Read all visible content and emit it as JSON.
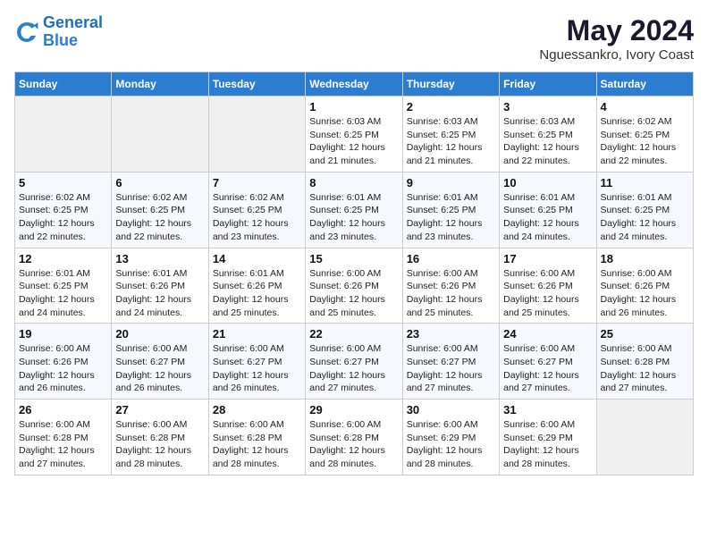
{
  "logo": {
    "line1": "General",
    "line2": "Blue"
  },
  "title": "May 2024",
  "location": "Nguessankro, Ivory Coast",
  "weekdays": [
    "Sunday",
    "Monday",
    "Tuesday",
    "Wednesday",
    "Thursday",
    "Friday",
    "Saturday"
  ],
  "weeks": [
    [
      {
        "day": "",
        "info": ""
      },
      {
        "day": "",
        "info": ""
      },
      {
        "day": "",
        "info": ""
      },
      {
        "day": "1",
        "info": "Sunrise: 6:03 AM\nSunset: 6:25 PM\nDaylight: 12 hours\nand 21 minutes."
      },
      {
        "day": "2",
        "info": "Sunrise: 6:03 AM\nSunset: 6:25 PM\nDaylight: 12 hours\nand 21 minutes."
      },
      {
        "day": "3",
        "info": "Sunrise: 6:03 AM\nSunset: 6:25 PM\nDaylight: 12 hours\nand 22 minutes."
      },
      {
        "day": "4",
        "info": "Sunrise: 6:02 AM\nSunset: 6:25 PM\nDaylight: 12 hours\nand 22 minutes."
      }
    ],
    [
      {
        "day": "5",
        "info": "Sunrise: 6:02 AM\nSunset: 6:25 PM\nDaylight: 12 hours\nand 22 minutes."
      },
      {
        "day": "6",
        "info": "Sunrise: 6:02 AM\nSunset: 6:25 PM\nDaylight: 12 hours\nand 22 minutes."
      },
      {
        "day": "7",
        "info": "Sunrise: 6:02 AM\nSunset: 6:25 PM\nDaylight: 12 hours\nand 23 minutes."
      },
      {
        "day": "8",
        "info": "Sunrise: 6:01 AM\nSunset: 6:25 PM\nDaylight: 12 hours\nand 23 minutes."
      },
      {
        "day": "9",
        "info": "Sunrise: 6:01 AM\nSunset: 6:25 PM\nDaylight: 12 hours\nand 23 minutes."
      },
      {
        "day": "10",
        "info": "Sunrise: 6:01 AM\nSunset: 6:25 PM\nDaylight: 12 hours\nand 24 minutes."
      },
      {
        "day": "11",
        "info": "Sunrise: 6:01 AM\nSunset: 6:25 PM\nDaylight: 12 hours\nand 24 minutes."
      }
    ],
    [
      {
        "day": "12",
        "info": "Sunrise: 6:01 AM\nSunset: 6:25 PM\nDaylight: 12 hours\nand 24 minutes."
      },
      {
        "day": "13",
        "info": "Sunrise: 6:01 AM\nSunset: 6:26 PM\nDaylight: 12 hours\nand 24 minutes."
      },
      {
        "day": "14",
        "info": "Sunrise: 6:01 AM\nSunset: 6:26 PM\nDaylight: 12 hours\nand 25 minutes."
      },
      {
        "day": "15",
        "info": "Sunrise: 6:00 AM\nSunset: 6:26 PM\nDaylight: 12 hours\nand 25 minutes."
      },
      {
        "day": "16",
        "info": "Sunrise: 6:00 AM\nSunset: 6:26 PM\nDaylight: 12 hours\nand 25 minutes."
      },
      {
        "day": "17",
        "info": "Sunrise: 6:00 AM\nSunset: 6:26 PM\nDaylight: 12 hours\nand 25 minutes."
      },
      {
        "day": "18",
        "info": "Sunrise: 6:00 AM\nSunset: 6:26 PM\nDaylight: 12 hours\nand 26 minutes."
      }
    ],
    [
      {
        "day": "19",
        "info": "Sunrise: 6:00 AM\nSunset: 6:26 PM\nDaylight: 12 hours\nand 26 minutes."
      },
      {
        "day": "20",
        "info": "Sunrise: 6:00 AM\nSunset: 6:27 PM\nDaylight: 12 hours\nand 26 minutes."
      },
      {
        "day": "21",
        "info": "Sunrise: 6:00 AM\nSunset: 6:27 PM\nDaylight: 12 hours\nand 26 minutes."
      },
      {
        "day": "22",
        "info": "Sunrise: 6:00 AM\nSunset: 6:27 PM\nDaylight: 12 hours\nand 27 minutes."
      },
      {
        "day": "23",
        "info": "Sunrise: 6:00 AM\nSunset: 6:27 PM\nDaylight: 12 hours\nand 27 minutes."
      },
      {
        "day": "24",
        "info": "Sunrise: 6:00 AM\nSunset: 6:27 PM\nDaylight: 12 hours\nand 27 minutes."
      },
      {
        "day": "25",
        "info": "Sunrise: 6:00 AM\nSunset: 6:28 PM\nDaylight: 12 hours\nand 27 minutes."
      }
    ],
    [
      {
        "day": "26",
        "info": "Sunrise: 6:00 AM\nSunset: 6:28 PM\nDaylight: 12 hours\nand 27 minutes."
      },
      {
        "day": "27",
        "info": "Sunrise: 6:00 AM\nSunset: 6:28 PM\nDaylight: 12 hours\nand 28 minutes."
      },
      {
        "day": "28",
        "info": "Sunrise: 6:00 AM\nSunset: 6:28 PM\nDaylight: 12 hours\nand 28 minutes."
      },
      {
        "day": "29",
        "info": "Sunrise: 6:00 AM\nSunset: 6:28 PM\nDaylight: 12 hours\nand 28 minutes."
      },
      {
        "day": "30",
        "info": "Sunrise: 6:00 AM\nSunset: 6:29 PM\nDaylight: 12 hours\nand 28 minutes."
      },
      {
        "day": "31",
        "info": "Sunrise: 6:00 AM\nSunset: 6:29 PM\nDaylight: 12 hours\nand 28 minutes."
      },
      {
        "day": "",
        "info": ""
      }
    ]
  ]
}
